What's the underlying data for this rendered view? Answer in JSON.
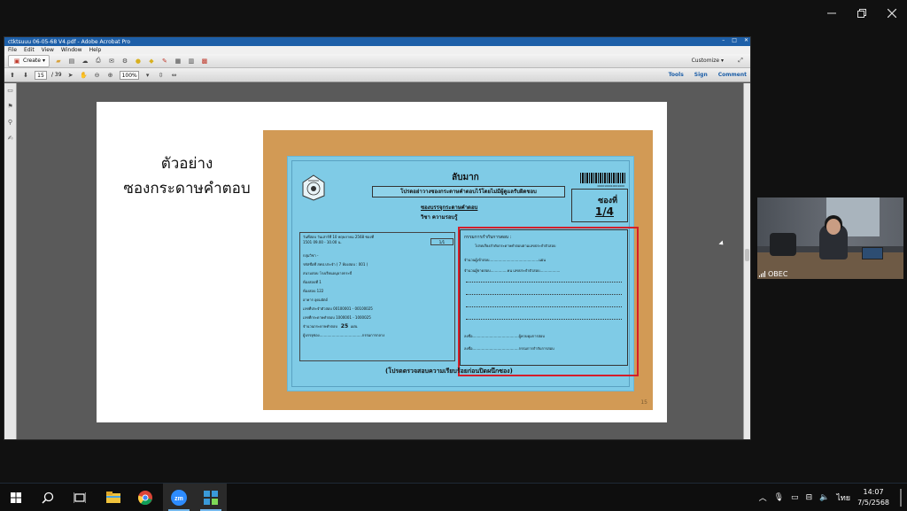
{
  "acrobat": {
    "title": "ctktsuuu 06-05-68 V4.pdf - Adobe Acrobat Pro",
    "menu": [
      "File",
      "Edit",
      "View",
      "Window",
      "Help"
    ],
    "create_label": "Create",
    "page_current": "15",
    "page_total": "/ 39",
    "zoom": "100%",
    "customize_label": "Customize",
    "tools_label": "Tools",
    "sign_label": "Sign",
    "comment_label": "Comment"
  },
  "slide": {
    "heading_line1": "ตัวอย่าง",
    "heading_line2": "ซองกระดาษคำตอบ",
    "page_number": "15",
    "card": {
      "stamp": "ลับมาก",
      "notice": "โปรดอย่าวางซองกระดาษคำตอบไว้โดยไม่มีผู้ดูแลรับผิดชอบ",
      "subtitle": "ซองบรรจุกระดาษคำตอบ",
      "subject": "วิชา ความรอบรู้",
      "envelope_label": "ซองที่",
      "envelope_value": "1/4",
      "barcode_text": "0000100010001000",
      "info_top": "วันที่สอบ   วันเสาร์ที่ 10 พฤษภาคม 2568   ซองที่",
      "info_top2": "1501   09.00 - 10.00 น.",
      "env_small": "1/1",
      "info_rows": [
        "กลุ่มวิชา -",
        "รหัสชื่อที่ สพป.ประจำ ( 7 ห้องสอบ : 001 )",
        "สนามสอบ โรงเรียนอนุบาลกระบี่",
        "ห้องสอบที่ 1",
        "ห้องสอบ 122",
        "อาคาร อุดมอัตถ์",
        "เลขที่ประจำตัวสอบ   00100001 - 00100025",
        "เลขที่กระดาษคำตอบ   1000001 - 1000025",
        "ผู้บรรจุซอง......................................กรรมการกลาง"
      ],
      "count_label": "จำนวนกระดาษคำตอบ",
      "count_value": "25",
      "count_unit": "แผ่น",
      "committee_title": "กรรมการกำกับการสอบ :",
      "committee_sub": "โปรดเรียงลำดับกระดาษคำตอบตามเลขประจำตัวสอบ",
      "committee_lines": [
        "จำนวนผู้เข้าสอบ............................................แผ่น",
        "จำนวนผู้ขาดสอบ...............คน เลขประจำตัวสอบ..................",
        "ลงชื่อ.........................................ผู้ควบคุมการสอบ",
        "ลงชื่อ.........................................กรรมการกำกับการสอบ"
      ],
      "footer": "(โปรดตรวจสอบความเรียบร้อยก่อนปิดผนึกซอง)"
    }
  },
  "video": {
    "participant_name": "OBEC"
  },
  "taskbar": {
    "language": "ไทย",
    "time": "14:07",
    "date": "7/5/2568"
  },
  "colors": {
    "card_blue": "#7fcbe6",
    "envelope_tan": "#d29a55",
    "highlight_red": "#d41e2a",
    "acrobat_title": "#1d5fa8"
  }
}
